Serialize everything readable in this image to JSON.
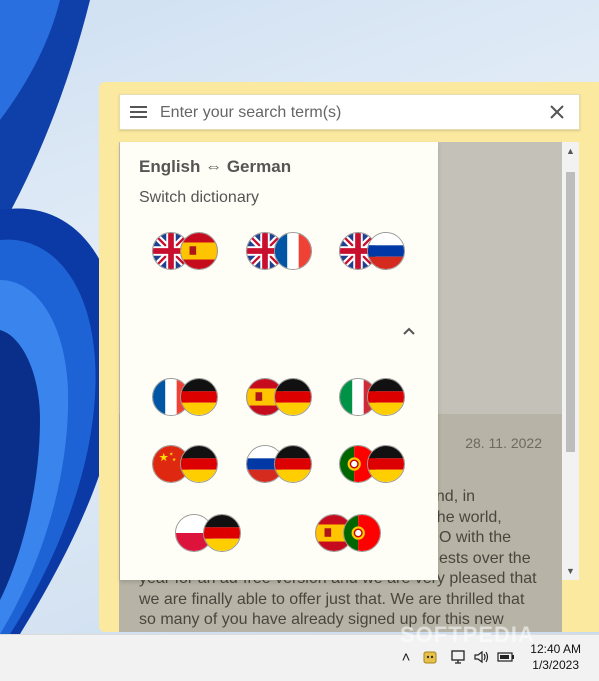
{
  "search": {
    "placeholder": "Enter your search term(s)"
  },
  "dictionary": {
    "current": "English ⇔ German",
    "switch_label": "Switch dictionary",
    "pairs_top": [
      {
        "from": "en",
        "to": "es"
      },
      {
        "from": "en",
        "to": "fr"
      },
      {
        "from": "en",
        "to": "ru"
      }
    ],
    "pairs_bottom": [
      {
        "from": "fr",
        "to": "de"
      },
      {
        "from": "es",
        "to": "de"
      },
      {
        "from": "it",
        "to": "de"
      },
      {
        "from": "cn",
        "to": "de"
      },
      {
        "from": "ru",
        "to": "de"
      },
      {
        "from": "pt",
        "to": "de"
      },
      {
        "from": "pl",
        "to": "de"
      },
      {
        "from": "es",
        "to": "pt"
      }
    ]
  },
  "article": {
    "date": "28. 11. 2022",
    "lines": [
      "and, in",
      "n the world,",
      "O with the",
      "ests over the",
      "year for an ad-free version and we are very pleased that",
      "we are finally able to offer just that. We are thrilled that",
      "so many of you have already signed up for this new"
    ]
  },
  "taskbar": {
    "time": "12:40 AM",
    "date": "1/3/2023",
    "watermark": "SOFTPEDIA"
  },
  "icons": {
    "menu": "hamburger-icon",
    "clear": "close-icon",
    "collapse": "chevron-up-icon"
  }
}
